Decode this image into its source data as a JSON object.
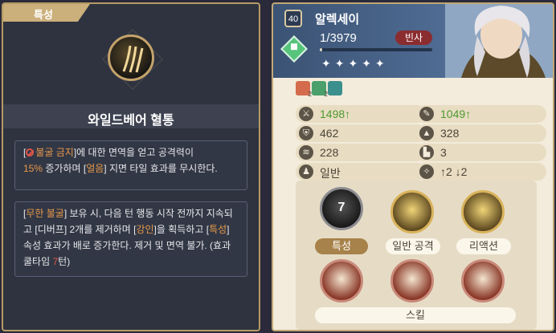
{
  "left": {
    "tab_label": "특성",
    "skill_title": "와일드베어 혈통",
    "desc1": {
      "p1": "[",
      "ban_text": "불굴 금지",
      "p2": "]에 대한 면역을 얻고 공격력이",
      "pct": "15%",
      "p3": " 증가하며 [",
      "freeze": "얼음",
      "p4": "] 지면 타일 효과를 무시한다."
    },
    "desc2": {
      "p1": "[",
      "infinite": "무한 불굴",
      "p2": "] 보유 시, 다음 턴 행동 시작 전까지 지속되고 [디버프] 2개를 제거하며 [",
      "strong": "강인",
      "p3": "]을 획득하고 [",
      "trait": "특성",
      "p4": "] 속성 효과가 배로 증가한다. 제거 및 면역 불가. (효과 쿨타임 ",
      "cooldown": "7",
      "p5": "턴)"
    }
  },
  "hero": {
    "level": "40",
    "name": "알렉세이",
    "exp_text": "1/3979",
    "exp_progress": 0.0003,
    "status_button": "빈사",
    "stars": "✦✦✦✦✦",
    "element_icon": "leaf-diamond-icon"
  },
  "buffs": [
    {
      "icon": "red-claw-buff-icon",
      "count": "2",
      "color": "#d36b4c"
    },
    {
      "icon": "green-arrow-buff-icon",
      "count": "2",
      "color": "#4a9f6a"
    },
    {
      "icon": "teal-paw-buff-icon",
      "count": "",
      "color": "#3b8f8c"
    }
  ],
  "stats": {
    "attack": {
      "value": "1498",
      "trend": "↑",
      "icon": "sword-icon"
    },
    "magic": {
      "value": "1049",
      "trend": "↑",
      "icon": "wand-icon"
    },
    "defense": {
      "value": "462",
      "icon": "shield-icon"
    },
    "magic_defense": {
      "value": "328",
      "icon": "hat-icon"
    },
    "speed": {
      "value": "228",
      "icon": "wing-icon"
    },
    "move": {
      "value": "3",
      "icon": "boot-icon"
    },
    "class": {
      "value": "일반",
      "icon": "pawn-icon"
    },
    "jump": {
      "value": "↑2 ↓2",
      "icon": "jump-icon"
    }
  },
  "skills": {
    "trait_label": "특성",
    "trait_cooldown": "7",
    "normal_attack_label": "일반 공격",
    "reaction_label": "리액션",
    "skill_label": "스킬"
  },
  "colors": {
    "accent_orange": "#e99a4a",
    "accent_red": "#e05548",
    "stat_up_green": "#4f9a30",
    "panel_dark": "#2f3340",
    "panel_light": "#f3ebdb"
  }
}
